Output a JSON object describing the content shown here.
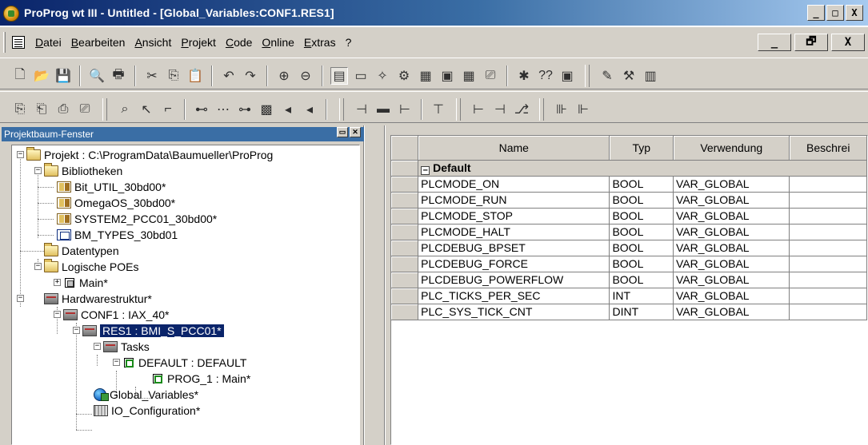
{
  "window": {
    "title": "ProProg wt III - Untitled - [Global_Variables:CONF1.RES1]",
    "minimize": "_",
    "maximize": "□",
    "close": "X"
  },
  "menu": {
    "items": [
      "Datei",
      "Bearbeiten",
      "Ansicht",
      "Projekt",
      "Code",
      "Online",
      "Extras",
      "?"
    ],
    "mdi_minimize": "_",
    "mdi_restore": "🗗",
    "mdi_close": "X"
  },
  "toolbar1": {
    "icons": [
      "new-file-icon",
      "open-folder-icon",
      "save-icon",
      "print-preview-icon",
      "print-icon",
      "cut-icon",
      "copy-icon",
      "paste-icon",
      "undo-icon",
      "redo-icon",
      "zoom-in-icon",
      "zoom-out-icon",
      "project-tree-icon",
      "message-window-icon",
      "wizard-icon",
      "online-icon",
      "library-icon",
      "watch-icon",
      "grid-icon",
      "compile-icon",
      "search-icon",
      "help-icon",
      "monitor-icon",
      "edit-icon",
      "tools-icon",
      "config-icon"
    ],
    "help_text": "??"
  },
  "toolbar2": {
    "icons": [
      "insert-pou-icon",
      "insert-var-icon",
      "insert-type-icon",
      "insert-fb-icon",
      "select-icon",
      "pointer-icon",
      "line-icon",
      "connector-icon",
      "comment-icon",
      "jump-icon",
      "fb-call-icon",
      "contact-icon",
      "coil-icon",
      "ladder-left-icon",
      "ladder-mid-icon",
      "ladder-right-icon",
      "branch-icon",
      "rung-left-icon",
      "rung-right-icon",
      "network-icon",
      "contact-no-icon",
      "contact-nc-icon"
    ]
  },
  "tree_panel": {
    "title": "Projektbaum-Fenster",
    "nodes": [
      {
        "label": "Projekt : C:\\ProgramData\\Baumueller\\ProProg",
        "icon": "folder-icon"
      },
      {
        "label": "Bibliotheken",
        "icon": "folder-icon"
      },
      {
        "label": "Bit_UTIL_30bd00*",
        "icon": "library-icon"
      },
      {
        "label": "OmegaOS_30bd00*",
        "icon": "library-icon"
      },
      {
        "label": "SYSTEM2_PCC01_30bd00*",
        "icon": "library-icon"
      },
      {
        "label": "BM_TYPES_30bd01",
        "icon": "book-icon"
      },
      {
        "label": "Datentypen",
        "icon": "folder-icon"
      },
      {
        "label": "Logische POEs",
        "icon": "folder-icon"
      },
      {
        "label": "Main*",
        "icon": "pou-icon"
      },
      {
        "label": "Hardwarestruktur*",
        "icon": "hardware-icon"
      },
      {
        "label": "CONF1 : IAX_40*",
        "icon": "hardware-icon"
      },
      {
        "label": "RES1 : BMI_S_PCC01*",
        "icon": "hardware-icon"
      },
      {
        "label": "Tasks",
        "icon": "hardware-icon"
      },
      {
        "label": "DEFAULT : DEFAULT",
        "icon": "task-icon"
      },
      {
        "label": "PROG_1 : Main*",
        "icon": "program-icon"
      },
      {
        "label": "Global_Variables*",
        "icon": "global-variables-icon"
      },
      {
        "label": "IO_Configuration*",
        "icon": "io-config-icon"
      }
    ]
  },
  "grid": {
    "columns": [
      "Name",
      "Typ",
      "Verwendung",
      "Beschrei"
    ],
    "group": "Default",
    "rows": [
      [
        "PLCMODE_ON",
        "BOOL",
        "VAR_GLOBAL",
        ""
      ],
      [
        "PLCMODE_RUN",
        "BOOL",
        "VAR_GLOBAL",
        ""
      ],
      [
        "PLCMODE_STOP",
        "BOOL",
        "VAR_GLOBAL",
        ""
      ],
      [
        "PLCMODE_HALT",
        "BOOL",
        "VAR_GLOBAL",
        ""
      ],
      [
        "PLCDEBUG_BPSET",
        "BOOL",
        "VAR_GLOBAL",
        ""
      ],
      [
        "PLCDEBUG_FORCE",
        "BOOL",
        "VAR_GLOBAL",
        ""
      ],
      [
        "PLCDEBUG_POWERFLOW",
        "BOOL",
        "VAR_GLOBAL",
        ""
      ],
      [
        "PLC_TICKS_PER_SEC",
        "INT",
        "VAR_GLOBAL",
        ""
      ],
      [
        "PLC_SYS_TICK_CNT",
        "DINT",
        "VAR_GLOBAL",
        ""
      ]
    ]
  }
}
